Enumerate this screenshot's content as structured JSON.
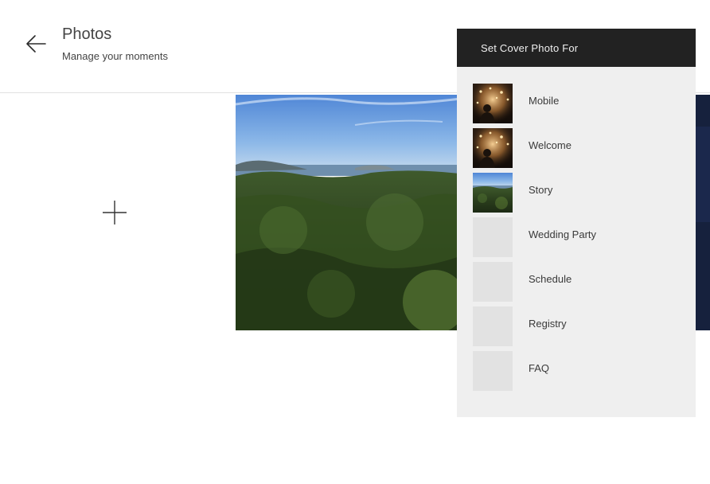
{
  "header": {
    "title": "Photos",
    "subtitle": "Manage your moments",
    "back_icon": "arrow-left-icon"
  },
  "gallery": {
    "add_icon": "plus-icon"
  },
  "cover_menu": {
    "heading": "Set Cover Photo For",
    "items": [
      {
        "label": "Mobile",
        "thumb": "lights"
      },
      {
        "label": "Welcome",
        "thumb": "lights"
      },
      {
        "label": "Story",
        "thumb": "landscape"
      },
      {
        "label": "Wedding Party",
        "thumb": "empty"
      },
      {
        "label": "Schedule",
        "thumb": "empty"
      },
      {
        "label": "Registry",
        "thumb": "empty"
      },
      {
        "label": "FAQ",
        "thumb": "empty"
      }
    ]
  },
  "colors": {
    "menu_header_bg": "#222222",
    "menu_bg": "#efefef",
    "placeholder": "#e2e2e2"
  }
}
